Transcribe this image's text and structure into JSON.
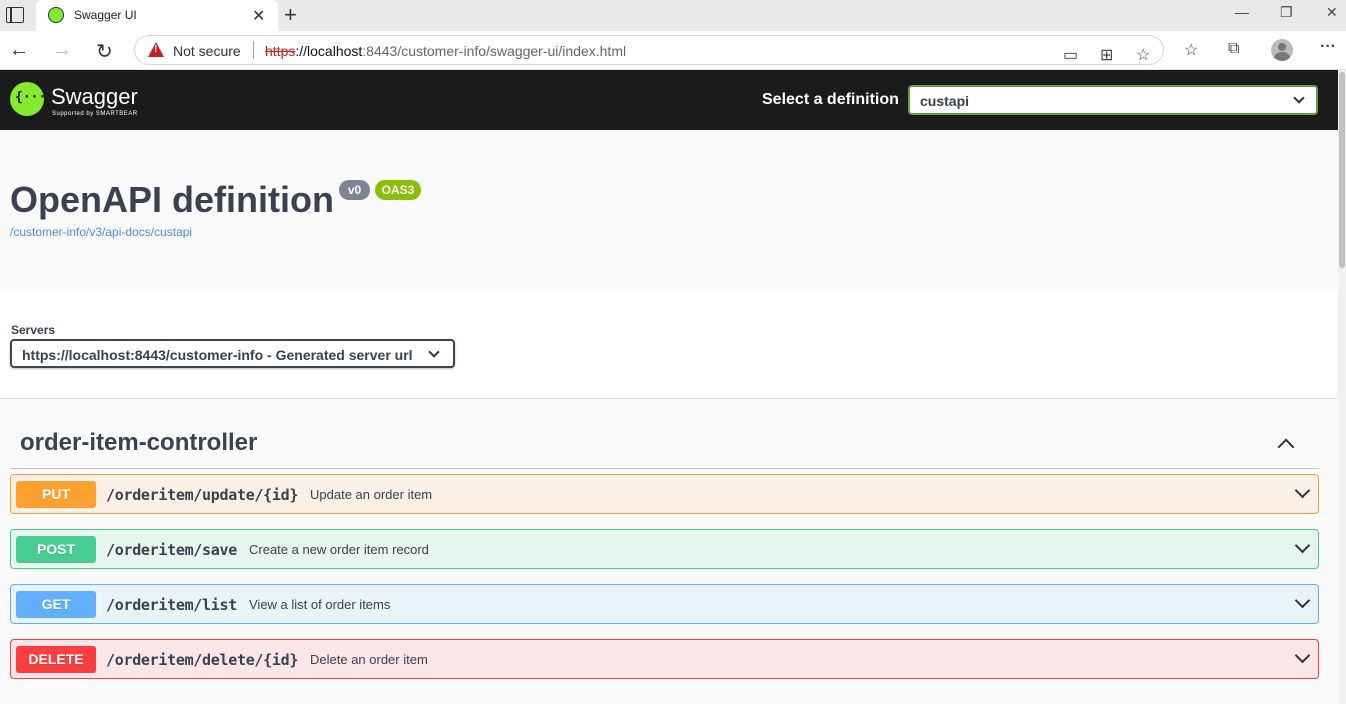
{
  "browser": {
    "tab_title": "Swagger UI",
    "not_secure": "Not secure",
    "url_scheme": "https",
    "url_host": "://localhost",
    "url_rest": ":8443/customer-info/swagger-ui/index.html"
  },
  "topbar": {
    "logo_text": "Swagger",
    "logo_sub": "Supported by SMARTBEAR",
    "logo_glyph": "{···}",
    "definition_label": "Select a definition",
    "definition_value": "custapi"
  },
  "info": {
    "title": "OpenAPI definition",
    "version_badge": "v0",
    "oas_badge": "OAS3",
    "spec_url": "/customer-info/v3/api-docs/custapi"
  },
  "servers": {
    "label": "Servers",
    "selected": "https://localhost:8443/customer-info - Generated server url"
  },
  "tag": {
    "name": "order-item-controller"
  },
  "operations": [
    {
      "method": "PUT",
      "path": "/orderitem/update/{id}",
      "summary": "Update an order item",
      "color": "#fca130"
    },
    {
      "method": "POST",
      "path": "/orderitem/save",
      "summary": "Create a new order item record",
      "color": "#49cc90"
    },
    {
      "method": "GET",
      "path": "/orderitem/list",
      "summary": "View a list of order items",
      "color": "#61affe"
    },
    {
      "method": "DELETE",
      "path": "/orderitem/delete/{id}",
      "summary": "Delete an order item",
      "color": "#f93e3e"
    }
  ]
}
